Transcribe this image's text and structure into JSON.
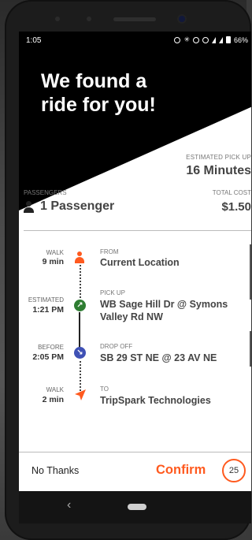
{
  "status_bar": {
    "time": "1:05",
    "battery": "66%"
  },
  "hero": {
    "title_line1": "We found a",
    "title_line2": "ride for you!"
  },
  "pickup_estimate": {
    "label": "ESTIMATED PICK UP",
    "value": "16 Minutes"
  },
  "passengers": {
    "label": "PASSENGERS",
    "value": "1 Passenger"
  },
  "cost": {
    "label": "TOTAL COST",
    "value": "$1.50"
  },
  "stops": [
    {
      "meta_label": "WALK",
      "meta_value": "9 min",
      "label": "FROM",
      "value": "Current Location",
      "icon": "walk-person-icon"
    },
    {
      "meta_label": "ESTIMATED",
      "meta_value": "1:21 PM",
      "label": "PICK UP",
      "value": "WB Sage Hill Dr @ Symons Valley Rd NW",
      "icon": "pickup-arrow-icon"
    },
    {
      "meta_label": "BEFORE",
      "meta_value": "2:05 PM",
      "label": "DROP OFF",
      "value": "SB 29 ST NE @ 23 AV NE",
      "icon": "dropoff-arrow-icon"
    },
    {
      "meta_label": "WALK",
      "meta_value": "2 min",
      "label": "TO",
      "value": "TripSpark Technologies",
      "icon": "navigation-arrow-icon"
    }
  ],
  "actions": {
    "decline": "No Thanks",
    "confirm": "Confirm",
    "countdown": "25"
  },
  "colors": {
    "accent": "#ff5a1f",
    "pickup": "#2e7d32",
    "dropoff": "#3f51b5"
  }
}
